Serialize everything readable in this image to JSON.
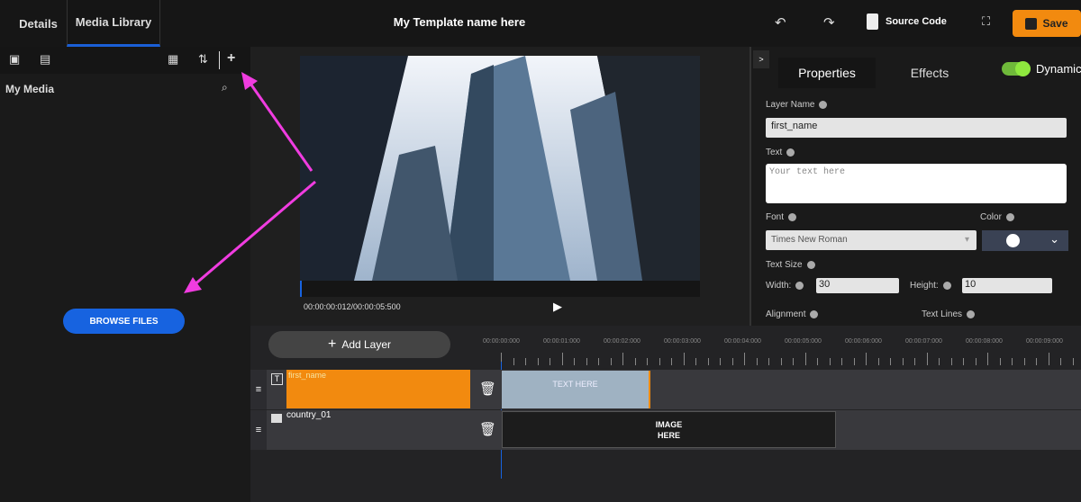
{
  "tabs": [
    {
      "label": "Details"
    },
    {
      "label": "Media Library"
    }
  ],
  "header": {
    "title": "My Template name here",
    "source_code": "Source Code",
    "save": "Save"
  },
  "media": {
    "title": "My Media",
    "browse": "BROWSE FILES"
  },
  "preview": {
    "timecode": "00:00:00:012/00:00:05:500"
  },
  "props": {
    "tabs": [
      "Properties",
      "Effects"
    ],
    "dynamic": "Dynamic",
    "layer_name_label": "Layer Name",
    "layer_name": "first_name",
    "text_label": "Text",
    "text_placeholder": "Your text here",
    "font_label": "Font",
    "font": "Times New Roman",
    "color_label": "Color",
    "color": "#ffffff",
    "text_size_label": "Text Size",
    "width_label": "Width:",
    "width": "30",
    "height_label": "Height:",
    "height": "10",
    "alignment_label": "Alignment",
    "text_lines_label": "Text Lines"
  },
  "timeline": {
    "add_layer": "Add Layer",
    "ticks": [
      "00:00:00:000",
      "00:00:01:000",
      "00:00:02:000",
      "00:00:03:000",
      "00:00:04:000",
      "00:00:05:000",
      "00:00:06:000",
      "00:00:07:000",
      "00:00:08:000",
      "00:00:09:000"
    ],
    "layers": [
      {
        "name": "first_name",
        "clip": "TEXT HERE"
      },
      {
        "name": "country_01",
        "clip": "IMAGE HERE"
      }
    ]
  },
  "colors": {
    "accent": "#f28a0f",
    "primary": "#1763e0",
    "annotation": "#f03ce0"
  }
}
